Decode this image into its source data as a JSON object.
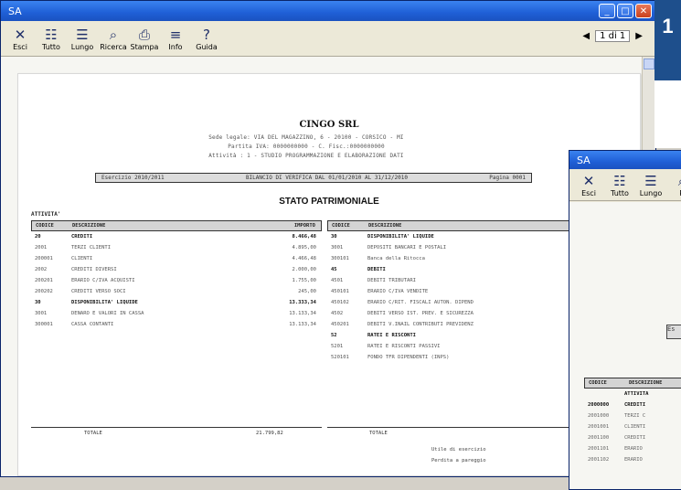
{
  "window": {
    "title": "SA"
  },
  "toolbar": {
    "buttons": [
      {
        "icon": "exit-icon",
        "glyph": "✕",
        "label": "Esci"
      },
      {
        "icon": "tutto-icon",
        "glyph": "☷",
        "label": "Tutto"
      },
      {
        "icon": "lungo-icon",
        "glyph": "☰",
        "label": "Lungo"
      },
      {
        "icon": "ricerca-icon",
        "glyph": "⌕",
        "label": "Ricerca"
      },
      {
        "icon": "print-icon",
        "glyph": "⎙",
        "label": "Stampa"
      },
      {
        "icon": "info-icon",
        "glyph": "≡",
        "label": "Info"
      },
      {
        "icon": "help-icon",
        "glyph": "?",
        "label": "Guida"
      }
    ],
    "pager": {
      "text": "1 di 1"
    }
  },
  "report": {
    "company": "CINGO SRL",
    "address_lines": [
      "Sede legale: VIA DEL MAGAZZINO, 6 - 20100 - CORSICO - MI",
      "Partita IVA: 0000000000 - C. Fisc.:0000000000",
      "Attività : 1 - STUDIO PROGRAMMAZIONE E ELABORAZIONE DATI"
    ],
    "period": {
      "left": "Esercizio 2010/2011",
      "center": "BILANCIO DI VERIFICA DAL 01/01/2010 AL 31/12/2010",
      "right": "Pagina 0001"
    },
    "title": "STATO PATRIMONIALE",
    "section_left": "ATTIVITA'",
    "headers": {
      "code": "CODICE",
      "desc": "DESCRIZIONE",
      "amount": "IMPORTO"
    },
    "left_rows": [
      {
        "code": "20",
        "desc": "CREDITI",
        "amount": "8.466,48",
        "bold": true
      },
      {
        "code": "2001",
        "desc": "TERZI CLIENTI",
        "amount": "4.895,00",
        "bold": false
      },
      {
        "code": "200001",
        "desc": "CLIENTI",
        "amount": "4.466,48",
        "bold": false
      },
      {
        "code": "2002",
        "desc": "CREDITI DIVERSI",
        "amount": "2.000,00",
        "bold": false
      },
      {
        "code": "200201",
        "desc": "ERARIO C/IVA ACQUISTI",
        "amount": "1.755,00",
        "bold": false
      },
      {
        "code": "200202",
        "desc": "CREDITI VERSO SOCI",
        "amount": "245,00",
        "bold": false
      },
      {
        "code": "30",
        "desc": "DISPONIBILITA' LIQUIDE",
        "amount": "13.333,34",
        "bold": true
      },
      {
        "code": "3001",
        "desc": "DENARO E VALORI IN CASSA",
        "amount": "13.133,34",
        "bold": false
      },
      {
        "code": "300001",
        "desc": "CASSA CONTANTI",
        "amount": "13.133,34",
        "bold": false
      }
    ],
    "left_total_label": "TOTALE",
    "left_total_value": "21.799,82",
    "right_rows": [
      {
        "code": "30",
        "desc": "DISPONIBILITA' LIQUIDE",
        "amount": "",
        "bold": true
      },
      {
        "code": "3001",
        "desc": "DEPOSITI BANCARI E POSTALI",
        "amount": "",
        "bold": false
      },
      {
        "code": "300101",
        "desc": "Banca della Ritocca",
        "amount": "",
        "bold": false
      },
      {
        "code": "45",
        "desc": "DEBITI",
        "amount": "",
        "bold": true
      },
      {
        "code": "4501",
        "desc": "DEBITI TRIBUTARI",
        "amount": "",
        "bold": false
      },
      {
        "code": "450101",
        "desc": "ERARIO C/IVA VENDITE",
        "amount": "",
        "bold": false
      },
      {
        "code": "450102",
        "desc": "ERARIO C/RIT. FISCALI AUTON. DIPEND",
        "amount": "",
        "bold": false
      },
      {
        "code": "4502",
        "desc": "DEBITI VERSO IST. PREV. E SICUREZZA",
        "amount": "",
        "bold": false
      },
      {
        "code": "450201",
        "desc": "DEBITI V.INAIL CONTRIBUTI PREVIDENZ",
        "amount": "",
        "bold": false
      },
      {
        "code": "52",
        "desc": "RATEI E RISCONTI",
        "amount": "",
        "bold": true
      },
      {
        "code": "5201",
        "desc": "RATEI E RISCONTI PASSIVI",
        "amount": "",
        "bold": false
      },
      {
        "code": "520101",
        "desc": "FONDO TFR DIPENDENTI (INPS)",
        "amount": "",
        "bold": false
      }
    ],
    "right_total_label": "TOTALE",
    "notes": [
      "Utile di esercizio",
      "Perdita a pareggio"
    ]
  },
  "second_window": {
    "title": "SA",
    "toolbar": [
      {
        "icon": "exit-icon",
        "glyph": "✕",
        "label": "Esci"
      },
      {
        "icon": "tutto-icon",
        "glyph": "☷",
        "label": "Tutto"
      },
      {
        "icon": "lungo-icon",
        "glyph": "☰",
        "label": "Lungo"
      },
      {
        "icon": "ricerca-icon",
        "glyph": "⌕",
        "label": "R"
      }
    ],
    "box_text": "Es",
    "headers": {
      "code": "CODICE",
      "desc": "DESCRIZIONE"
    },
    "rows": [
      {
        "code": "",
        "desc": "ATTIVITA",
        "bold": true
      },
      {
        "code": "2000000",
        "desc": "CREDITI",
        "bold": true
      },
      {
        "code": "2001000",
        "desc": "TERZI C",
        "bold": false
      },
      {
        "code": "2001001",
        "desc": "CLIENTI",
        "bold": false
      },
      {
        "code": "2001100",
        "desc": "CREDITI",
        "bold": false
      },
      {
        "code": "2001101",
        "desc": "ERARIO",
        "bold": false
      },
      {
        "code": "2001102",
        "desc": "ERARIO",
        "bold": false
      }
    ]
  },
  "badge": {
    "number": "1"
  }
}
